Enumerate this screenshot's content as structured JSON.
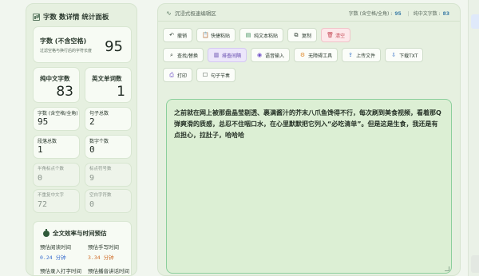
{
  "stats_panel": {
    "title": "字数 数详情 统计面板",
    "title_sup": "Ⓣ",
    "chars_no_space": {
      "label": "字数 (不含空格)",
      "sub": "过滤空格与换行后的字符长度",
      "value": "95"
    },
    "pure_chinese": {
      "label": "纯中文字数",
      "value": "83"
    },
    "english_words": {
      "label": "英文单词数",
      "value": "1"
    },
    "small": [
      {
        "label": "字数 (含空格/全角)",
        "value": "95",
        "muted": false
      },
      {
        "label": "句子总数",
        "value": "2",
        "muted": false
      },
      {
        "label": "段落总数",
        "value": "1",
        "muted": false
      },
      {
        "label": "数字个数",
        "value": "0",
        "muted": false
      },
      {
        "label": "半角标点个数",
        "value": "0",
        "muted": true
      },
      {
        "label": "标点符号数",
        "value": "9",
        "muted": true
      },
      {
        "label": "不重复中文字",
        "value": "72",
        "muted": true
      },
      {
        "label": "空白字符数",
        "value": "0",
        "muted": true
      }
    ],
    "efficiency": {
      "title": "全文效率与时间预估",
      "read_label": "预估阅读时间",
      "read_value": "0.24 分钟",
      "write_label": "预估手写时间",
      "write_value": "3.34 分钟",
      "type_label": "预估录入打字时间",
      "speak_label": "预估播音讲话时间",
      "colors": {
        "read": "#3b6fcf",
        "write": "#d0702c"
      }
    }
  },
  "editor_panel": {
    "title": "沉浸式极速编辑区",
    "stats_label_1": "字数 (含空格/全角) :",
    "stats_value_1": "95",
    "stats_label_2": "纯中文字数 :",
    "stats_value_2": "83",
    "toolbar_row1": [
      {
        "label": "撤销",
        "icon": "undo-icon",
        "glyph": "↶",
        "style": ""
      },
      {
        "label": "快捷粘贴",
        "icon": "clipboard-icon",
        "glyph": "📋",
        "style": ""
      },
      {
        "label": "纯文本粘贴",
        "icon": "paste-text-icon",
        "glyph": "▤",
        "style": "green"
      },
      {
        "label": "复制",
        "icon": "copy-icon",
        "glyph": "⧉",
        "style": ""
      },
      {
        "label": "清空",
        "icon": "trash-icon",
        "glyph": "🗑",
        "style": "danger"
      }
    ],
    "toolbar_row2": [
      {
        "label": "查找/替换",
        "icon": "search-icon",
        "glyph": "⌕",
        "style": ""
      },
      {
        "label": "排查间隔",
        "icon": "document-check-icon",
        "glyph": "▥",
        "style": "active"
      },
      {
        "label": "语音输入",
        "icon": "microphone-icon",
        "glyph": "◉",
        "style": "purple"
      },
      {
        "label": "无障碍工具",
        "icon": "accessibility-icon",
        "glyph": "⚙",
        "style": "warn"
      },
      {
        "label": "上传文件",
        "icon": "upload-icon",
        "glyph": "⇪",
        "style": "blue"
      },
      {
        "label": "下载TXT",
        "icon": "download-icon",
        "glyph": "⇩",
        "style": "blue"
      }
    ],
    "toolbar_row3": [
      {
        "label": "打印",
        "icon": "printer-icon",
        "glyph": "⎙",
        "style": "purple"
      },
      {
        "label": "句子节奏",
        "icon": "checkbox-icon",
        "glyph": "☐",
        "style": ""
      }
    ],
    "content": "之前就在网上被那盘晶莹剔透、裹满酱汁的芥末八爪鱼馋得不行，每次刷到美食视频，看着那Q弹爽滑的质感，总忍不住咽口水，在心里默默把它列入“必吃清单”。但是这是生食，我还是有点担心，拉肚子，哈哈哈"
  }
}
